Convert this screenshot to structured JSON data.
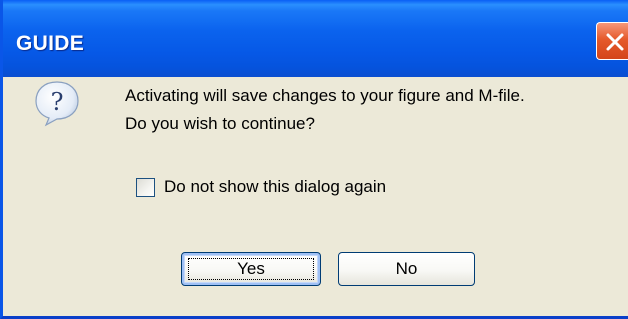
{
  "window": {
    "title": "GUIDE"
  },
  "dialog": {
    "message_line1": "Activating will save changes to your figure and M-file.",
    "message_line2": "Do you wish to continue?",
    "icon": "question-icon",
    "checkbox": {
      "label": "Do not show this dialog again",
      "checked": false
    },
    "buttons": {
      "yes_label": "Yes",
      "no_label": "No"
    }
  },
  "colors": {
    "titlebar": "#0a5ff5",
    "window_bg": "#ece9d8",
    "close_button": "#e55a2b"
  }
}
